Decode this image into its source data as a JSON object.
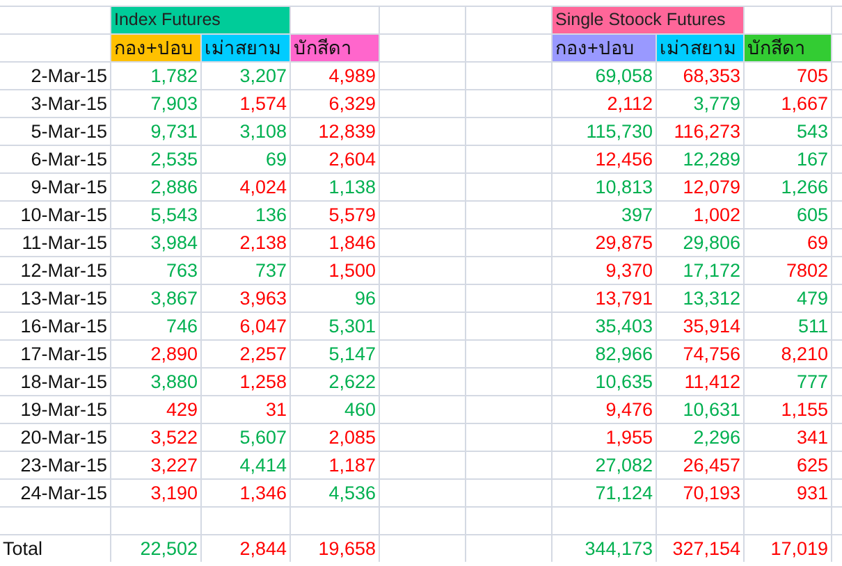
{
  "index_futures": {
    "title": "Index Futures",
    "color": "#00cc99",
    "columns": [
      {
        "label": "กอง+ปอบ",
        "color": "#ffc000"
      },
      {
        "label": "เม่าสยาม",
        "color": "#00ccff"
      },
      {
        "label": "บักสีดา",
        "color": "#ff66cc"
      }
    ]
  },
  "single_stock_futures": {
    "title": "Single Stoock Futures",
    "color": "#ff6699",
    "columns": [
      {
        "label": "กอง+ปอบ",
        "color": "#9999ff"
      },
      {
        "label": "เม่าสยาม",
        "color": "#00ccff"
      },
      {
        "label": "บักสีดา",
        "color": "#33cc33"
      }
    ]
  },
  "rows": [
    {
      "date": "2-Mar-15",
      "index": [
        {
          "value": "1,782",
          "color": "#00b050"
        },
        {
          "value": "3,207",
          "color": "#00b050"
        },
        {
          "value": "4,989",
          "color": "#ff0000"
        }
      ],
      "single": [
        {
          "value": "69,058",
          "color": "#00b050"
        },
        {
          "value": "68,353",
          "color": "#ff0000"
        },
        {
          "value": "705",
          "color": "#ff0000"
        }
      ]
    },
    {
      "date": "3-Mar-15",
      "index": [
        {
          "value": "7,903",
          "color": "#00b050"
        },
        {
          "value": "1,574",
          "color": "#ff0000"
        },
        {
          "value": "6,329",
          "color": "#ff0000"
        }
      ],
      "single": [
        {
          "value": "2,112",
          "color": "#ff0000"
        },
        {
          "value": "3,779",
          "color": "#00b050"
        },
        {
          "value": "1,667",
          "color": "#ff0000"
        }
      ]
    },
    {
      "date": "5-Mar-15",
      "index": [
        {
          "value": "9,731",
          "color": "#00b050"
        },
        {
          "value": "3,108",
          "color": "#00b050"
        },
        {
          "value": "12,839",
          "color": "#ff0000"
        }
      ],
      "single": [
        {
          "value": "115,730",
          "color": "#00b050"
        },
        {
          "value": "116,273",
          "color": "#ff0000"
        },
        {
          "value": "543",
          "color": "#00b050"
        }
      ]
    },
    {
      "date": "6-Mar-15",
      "index": [
        {
          "value": "2,535",
          "color": "#00b050"
        },
        {
          "value": "69",
          "color": "#00b050"
        },
        {
          "value": "2,604",
          "color": "#ff0000"
        }
      ],
      "single": [
        {
          "value": "12,456",
          "color": "#ff0000"
        },
        {
          "value": "12,289",
          "color": "#00b050"
        },
        {
          "value": "167",
          "color": "#00b050"
        }
      ]
    },
    {
      "date": "9-Mar-15",
      "index": [
        {
          "value": "2,886",
          "color": "#00b050"
        },
        {
          "value": "4,024",
          "color": "#ff0000"
        },
        {
          "value": "1,138",
          "color": "#00b050"
        }
      ],
      "single": [
        {
          "value": "10,813",
          "color": "#00b050"
        },
        {
          "value": "12,079",
          "color": "#ff0000"
        },
        {
          "value": "1,266",
          "color": "#00b050"
        }
      ]
    },
    {
      "date": "10-Mar-15",
      "index": [
        {
          "value": "5,543",
          "color": "#00b050"
        },
        {
          "value": "136",
          "color": "#00b050"
        },
        {
          "value": "5,579",
          "color": "#ff0000"
        }
      ],
      "single": [
        {
          "value": "397",
          "color": "#00b050"
        },
        {
          "value": "1,002",
          "color": "#ff0000"
        },
        {
          "value": "605",
          "color": "#00b050"
        }
      ]
    },
    {
      "date": "11-Mar-15",
      "index": [
        {
          "value": "3,984",
          "color": "#00b050"
        },
        {
          "value": "2,138",
          "color": "#ff0000"
        },
        {
          "value": "1,846",
          "color": "#ff0000"
        }
      ],
      "single": [
        {
          "value": "29,875",
          "color": "#ff0000"
        },
        {
          "value": "29,806",
          "color": "#00b050"
        },
        {
          "value": "69",
          "color": "#ff0000"
        }
      ]
    },
    {
      "date": "12-Mar-15",
      "index": [
        {
          "value": "763",
          "color": "#00b050"
        },
        {
          "value": "737",
          "color": "#00b050"
        },
        {
          "value": "1,500",
          "color": "#ff0000"
        }
      ],
      "single": [
        {
          "value": "9,370",
          "color": "#ff0000"
        },
        {
          "value": "17,172",
          "color": "#00b050"
        },
        {
          "value": "7802",
          "color": "#ff0000"
        }
      ]
    },
    {
      "date": "13-Mar-15",
      "index": [
        {
          "value": "3,867",
          "color": "#00b050"
        },
        {
          "value": "3,963",
          "color": "#ff0000"
        },
        {
          "value": "96",
          "color": "#00b050"
        }
      ],
      "single": [
        {
          "value": "13,791",
          "color": "#ff0000"
        },
        {
          "value": "13,312",
          "color": "#00b050"
        },
        {
          "value": "479",
          "color": "#00b050"
        }
      ]
    },
    {
      "date": "16-Mar-15",
      "index": [
        {
          "value": "746",
          "color": "#00b050"
        },
        {
          "value": "6,047",
          "color": "#ff0000"
        },
        {
          "value": "5,301",
          "color": "#00b050"
        }
      ],
      "single": [
        {
          "value": "35,403",
          "color": "#00b050"
        },
        {
          "value": "35,914",
          "color": "#ff0000"
        },
        {
          "value": "511",
          "color": "#00b050"
        }
      ]
    },
    {
      "date": "17-Mar-15",
      "index": [
        {
          "value": "2,890",
          "color": "#ff0000"
        },
        {
          "value": "2,257",
          "color": "#ff0000"
        },
        {
          "value": "5,147",
          "color": "#00b050"
        }
      ],
      "single": [
        {
          "value": "82,966",
          "color": "#00b050"
        },
        {
          "value": "74,756",
          "color": "#ff0000"
        },
        {
          "value": "8,210",
          "color": "#ff0000"
        }
      ]
    },
    {
      "date": "18-Mar-15",
      "index": [
        {
          "value": "3,880",
          "color": "#00b050"
        },
        {
          "value": "1,258",
          "color": "#ff0000"
        },
        {
          "value": "2,622",
          "color": "#00b050"
        }
      ],
      "single": [
        {
          "value": "10,635",
          "color": "#00b050"
        },
        {
          "value": "11,412",
          "color": "#ff0000"
        },
        {
          "value": "777",
          "color": "#00b050"
        }
      ]
    },
    {
      "date": "19-Mar-15",
      "index": [
        {
          "value": "429",
          "color": "#ff0000"
        },
        {
          "value": "31",
          "color": "#ff0000"
        },
        {
          "value": "460",
          "color": "#00b050"
        }
      ],
      "single": [
        {
          "value": "9,476",
          "color": "#ff0000"
        },
        {
          "value": "10,631",
          "color": "#00b050"
        },
        {
          "value": "1,155",
          "color": "#ff0000"
        }
      ]
    },
    {
      "date": "20-Mar-15",
      "index": [
        {
          "value": "3,522",
          "color": "#ff0000"
        },
        {
          "value": "5,607",
          "color": "#00b050"
        },
        {
          "value": "2,085",
          "color": "#ff0000"
        }
      ],
      "single": [
        {
          "value": "1,955",
          "color": "#ff0000"
        },
        {
          "value": "2,296",
          "color": "#00b050"
        },
        {
          "value": "341",
          "color": "#ff0000"
        }
      ]
    },
    {
      "date": "23-Mar-15",
      "index": [
        {
          "value": "3,227",
          "color": "#ff0000"
        },
        {
          "value": "4,414",
          "color": "#00b050"
        },
        {
          "value": "1,187",
          "color": "#ff0000"
        }
      ],
      "single": [
        {
          "value": "27,082",
          "color": "#00b050"
        },
        {
          "value": "26,457",
          "color": "#ff0000"
        },
        {
          "value": "625",
          "color": "#ff0000"
        }
      ]
    },
    {
      "date": "24-Mar-15",
      "index": [
        {
          "value": "3,190",
          "color": "#ff0000"
        },
        {
          "value": "1,346",
          "color": "#ff0000"
        },
        {
          "value": "4,536",
          "color": "#00b050"
        }
      ],
      "single": [
        {
          "value": "71,124",
          "color": "#00b050"
        },
        {
          "value": "70,193",
          "color": "#ff0000"
        },
        {
          "value": "931",
          "color": "#ff0000"
        }
      ]
    }
  ],
  "total": {
    "label": "Total",
    "index": [
      {
        "value": "22,502",
        "color": "#00b050"
      },
      {
        "value": "2,844",
        "color": "#ff0000"
      },
      {
        "value": "19,658",
        "color": "#ff0000"
      }
    ],
    "single": [
      {
        "value": "344,173",
        "color": "#00b050"
      },
      {
        "value": "327,154",
        "color": "#ff0000"
      },
      {
        "value": "17,019",
        "color": "#ff0000"
      }
    ]
  }
}
